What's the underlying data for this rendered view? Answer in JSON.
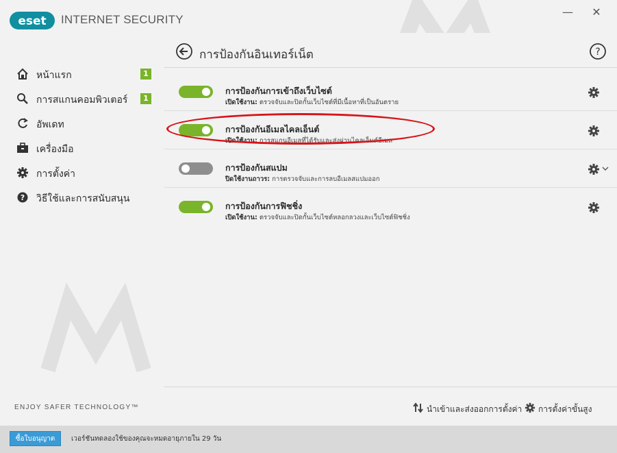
{
  "app": {
    "brand": "eset",
    "title": "INTERNET SECURITY",
    "minimize_label": "—",
    "close_label": "✕"
  },
  "sidebar": {
    "items": [
      {
        "label": "หน้าแรก",
        "icon": "home-icon",
        "badge": "1"
      },
      {
        "label": "การสแกนคอมพิวเตอร์",
        "icon": "search-icon",
        "badge": "1"
      },
      {
        "label": "อัพเดท",
        "icon": "refresh-icon"
      },
      {
        "label": "เครื่องมือ",
        "icon": "briefcase-icon"
      },
      {
        "label": "การตั้งค่า",
        "icon": "gear-icon"
      },
      {
        "label": "วิธีใช้และการสนับสนุน",
        "icon": "help-icon"
      }
    ],
    "tagline": "ENJOY SAFER TECHNOLOGY™"
  },
  "page": {
    "title": "การป้องกันอินเทอร์เน็ต"
  },
  "protections": [
    {
      "title": "การป้องกันการเข้าถึงเว็บไซต์",
      "status": "เปิดใช้งาน:",
      "desc": "ตรวจจับและปิดกั้นเว็บไซต์ที่มีเนื้อหาที่เป็นอันตราย",
      "enabled": true
    },
    {
      "title": "การป้องกันอีเมลไคลเอ็นต์",
      "status": "เปิดใช้งาน:",
      "desc": "การสแกนอีเมลที่ได้รับและส่งผ่านไคลเอ็นต์อีเมล",
      "enabled": true
    },
    {
      "title": "การป้องกันสแปม",
      "status": "ปิดใช้งานถาวร:",
      "desc": "การตรวจจับและการลบอีเมลสแปมออก",
      "enabled": false
    },
    {
      "title": "การป้องกันการฟิชชิ่ง",
      "status": "เปิดใช้งาน:",
      "desc": "ตรวจจับและปิดกั้นเว็บไซต์หลอกลวงและเว็บไซต์ฟิชชิ่ง",
      "enabled": true
    }
  ],
  "footer": {
    "import_export_label": "นำเข้าและส่งออกการตั้งค่า",
    "advanced_setup_label": "การตั้งค่าขั้นสูง"
  },
  "statusbar": {
    "buy_label": "ซื้อใบอนุญาต",
    "trial_text": "เวอร์ชันทดลองใช้ของคุณจะหมดอายุภายใน 29 วัน"
  },
  "colors": {
    "accent_green": "#7ab42a",
    "brand_teal": "#0f8fa0",
    "annotation_red": "#d8151b",
    "buy_blue": "#3a9bd6"
  }
}
